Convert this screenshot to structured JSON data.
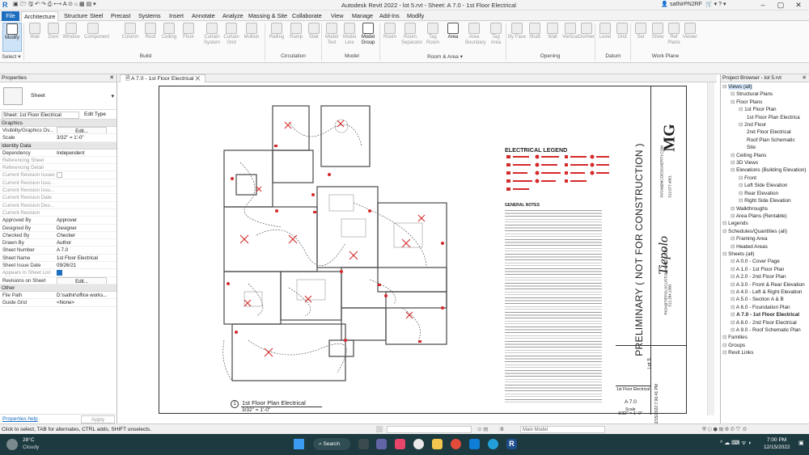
{
  "window": {
    "title": "Autodesk Revit 2022 - lot 5.rvt - Sheet: A 7.0 - 1st Floor Electrical",
    "user": "sathirPN2RF"
  },
  "menu_tabs": [
    "File",
    "Architecture",
    "Structure",
    "Steel",
    "Precast",
    "Systems",
    "Insert",
    "Annotate",
    "Analyze",
    "Massing & Site",
    "Collaborate",
    "View",
    "Manage",
    "Add-Ins",
    "Modify"
  ],
  "ribbon": {
    "modify": "Modify",
    "select": "Select ▾",
    "groups": {
      "build": "Build",
      "circulation": "Circulation",
      "model": "Model",
      "room_area": "Room & Area ▾",
      "opening": "Opening",
      "datum": "Datum",
      "work_plane": "Work Plane"
    },
    "build": [
      "Wall",
      "Door",
      "Window",
      "Component",
      "Column",
      "Roof",
      "Ceiling",
      "Floor",
      "Curtain System",
      "Curtain Grid",
      "Mullion"
    ],
    "circulation": [
      "Railing",
      "Ramp",
      "Stair"
    ],
    "model": [
      "Model Text",
      "Model Line",
      "Model Group"
    ],
    "room_area": [
      "Room",
      "Room Separator",
      "Tag Room",
      "Area",
      "Area Boundary",
      "Tag Area"
    ],
    "opening": [
      "By Face",
      "Shaft",
      "Wall",
      "Vertical",
      "Dormer"
    ],
    "datum": [
      "Level",
      "Grid"
    ],
    "work_plane": [
      "Set",
      "Show",
      "Ref Plane",
      "Viewer"
    ]
  },
  "properties": {
    "title": "Properties",
    "type": "Sheet",
    "selector": "Sheet: 1st Floor Electrical",
    "edit_type": "Edit Type",
    "sections": {
      "graphics": "Graphics",
      "identity": "Identity Data",
      "other": "Other"
    },
    "graphics": [
      {
        "k": "Visibility/Graphics Ov...",
        "v": "Edit..."
      },
      {
        "k": "Scale",
        "v": "3/32\" = 1'-0\""
      }
    ],
    "identity": [
      {
        "k": "Dependency",
        "v": "Independent"
      },
      {
        "k": "Referencing Sheet",
        "v": ""
      },
      {
        "k": "Referencing Detail",
        "v": ""
      },
      {
        "k": "Current Revision Issued",
        "v": ""
      },
      {
        "k": "Current Revision Issu...",
        "v": ""
      },
      {
        "k": "Current Revision Issu...",
        "v": ""
      },
      {
        "k": "Current Revision Date",
        "v": ""
      },
      {
        "k": "Current Revision Des...",
        "v": ""
      },
      {
        "k": "Current Revision",
        "v": ""
      },
      {
        "k": "Approved By",
        "v": "Approver"
      },
      {
        "k": "Designed By",
        "v": "Designer"
      },
      {
        "k": "Checked By",
        "v": "Checker"
      },
      {
        "k": "Drawn By",
        "v": "Author"
      },
      {
        "k": "Sheet Number",
        "v": "A 7.0"
      },
      {
        "k": "Sheet Name",
        "v": "1st Floor Electrical"
      },
      {
        "k": "Sheet Issue Date",
        "v": "09/26/21"
      },
      {
        "k": "Appears In Sheet List",
        "v": ""
      },
      {
        "k": "Revisions on Sheet",
        "v": "Edit..."
      }
    ],
    "other": [
      {
        "k": "File Path",
        "v": "D:\\sathir\\office works..."
      },
      {
        "k": "Guide Grid",
        "v": "<None>"
      }
    ],
    "help": "Properties help",
    "apply": "Apply"
  },
  "view": {
    "tab": "A 7.0 - 1st Floor Electrical",
    "legend_title": "ELECTRICAL LEGEND",
    "notes_heading": "GENERAL NOTES",
    "view_title": "1st Floor Plan Electrical",
    "view_number": "1",
    "view_scale": "3/32\" = 1'-0\"",
    "stamp": "PRELIMINARY ( NOT FOR CONSTRUCTION )",
    "company_initials": "MG",
    "company_email": "PAT.M@MCDESIGNERTY.COM",
    "company_phone": "512.677.4051",
    "brand": "Tiepolo",
    "brand_web": "RICK@TIEPOLOCUSTOMHOMES.COM",
    "brand_phone": "512.284.1300",
    "lot": "Lot 5",
    "sheet_name": "1st Floor Electrical",
    "sheet_number": "A 7.0",
    "scale_label": "Scale",
    "scale": "3/32\" = 1'-0\"",
    "date": "12/15/2022 7:00:41 PM"
  },
  "browser": {
    "title": "Project Browser - lot 5.rvt",
    "items": [
      {
        "t": "Views (all)",
        "i": 0,
        "icon": "views"
      },
      {
        "t": "Structural Plans",
        "i": 1
      },
      {
        "t": "Floor Plans",
        "i": 1
      },
      {
        "t": "1st Floor Plan",
        "i": 2
      },
      {
        "t": "1st Floor Plan Electrica",
        "i": 3
      },
      {
        "t": "2nd Floor",
        "i": 2
      },
      {
        "t": "2nd Floor Electrical",
        "i": 3
      },
      {
        "t": "Roof Plan Schematic",
        "i": 3
      },
      {
        "t": "Site",
        "i": 3
      },
      {
        "t": "Ceiling Plans",
        "i": 1
      },
      {
        "t": "3D Views",
        "i": 1
      },
      {
        "t": "Elevations (Building Elevation)",
        "i": 1
      },
      {
        "t": "Front",
        "i": 2
      },
      {
        "t": "Left Side Elevation",
        "i": 2
      },
      {
        "t": "Rear Elevation",
        "i": 2
      },
      {
        "t": "Right Side Elevation",
        "i": 2
      },
      {
        "t": "Walkthroughs",
        "i": 1
      },
      {
        "t": "Area Plans (Rentable)",
        "i": 1
      },
      {
        "t": "Legends",
        "i": 0
      },
      {
        "t": "Schedules/Quantities (all)",
        "i": 0
      },
      {
        "t": "Framing Area",
        "i": 1
      },
      {
        "t": "Heated Areas",
        "i": 1
      },
      {
        "t": "Sheets (all)",
        "i": 0
      },
      {
        "t": "A 0.0 - Cover Page",
        "i": 1
      },
      {
        "t": "A 1.0 - 1st Floor Plan",
        "i": 1
      },
      {
        "t": "A 2.0 - 2nd Floor Plan",
        "i": 1
      },
      {
        "t": "A 3.0 - Front & Rear Elevation",
        "i": 1
      },
      {
        "t": "A 4.0 - Left & Right Elevation",
        "i": 1
      },
      {
        "t": "A 5.0 - Section A & B",
        "i": 1
      },
      {
        "t": "A 6.0 - Foundation Plan",
        "i": 1
      },
      {
        "t": "A 7.0 - 1st Floor Electrical",
        "i": 1,
        "bold": true
      },
      {
        "t": "A 8.0 - 2nd Floor Electrical",
        "i": 1
      },
      {
        "t": "A 9.0 - Roof Schematic Plan",
        "i": 1
      },
      {
        "t": "Families",
        "i": 0
      },
      {
        "t": "Groups",
        "i": 0
      },
      {
        "t": "Revit Links",
        "i": 0
      }
    ]
  },
  "status": {
    "text": "Click to select, TAB for alternates, CTRL adds, SHIFT unselects.",
    "model": "Main Model",
    "zero": ":0"
  },
  "taskbar": {
    "temp": "28°C",
    "weather": "Cloudy",
    "search": "Search",
    "time": "7:00 PM",
    "date": "12/15/2022"
  },
  "colors": {
    "accent": "#1e6fc0",
    "taskbar": "#1c3a3f",
    "red": "#d42a2a"
  }
}
